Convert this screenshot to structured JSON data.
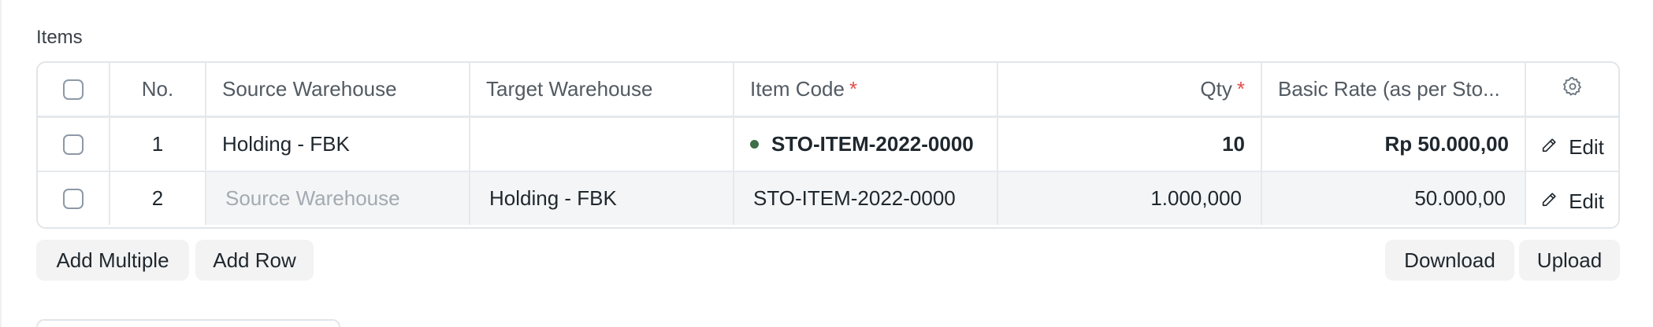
{
  "section": {
    "label": "Items"
  },
  "grid": {
    "columns": {
      "no": "No.",
      "source_warehouse": "Source Warehouse",
      "target_warehouse": "Target Warehouse",
      "item_code": "Item Code",
      "qty": "Qty",
      "basic_rate": "Basic Rate (as per Sto...",
      "required_mark": "*"
    },
    "rows": [
      {
        "no": "1",
        "source_warehouse": "Holding - FBK",
        "target_warehouse": "",
        "item_code": "STO-ITEM-2022-0000",
        "qty": "10",
        "basic_rate": "Rp 50.000,00",
        "edit": "Edit"
      },
      {
        "no": "2",
        "source_warehouse_placeholder": "Source Warehouse",
        "target_warehouse": "Holding - FBK",
        "item_code": "STO-ITEM-2022-0000",
        "qty": "1.000,000",
        "basic_rate": "50.000,00",
        "edit": "Edit"
      }
    ]
  },
  "actions": {
    "add_multiple": "Add Multiple",
    "add_row": "Add Row",
    "download": "Download",
    "upload": "Upload"
  },
  "icons": {
    "settings": "gear-icon",
    "edit": "pencil-icon",
    "status": "status-dot-icon"
  },
  "colors": {
    "required": "#e24c4c",
    "status_dot": "#3d6e47",
    "button_bg": "#f3f3f3"
  }
}
